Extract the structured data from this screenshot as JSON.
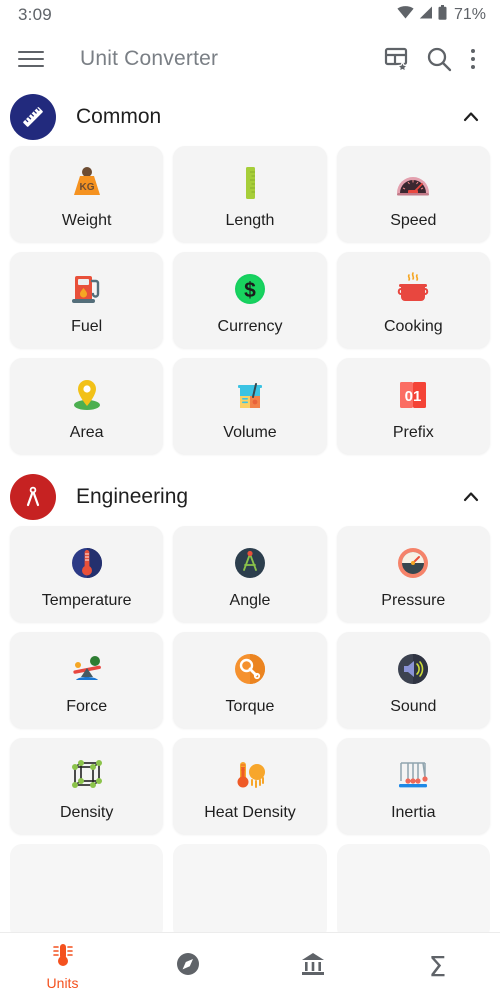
{
  "status_bar": {
    "clock": "3:09",
    "battery_percent": "71%",
    "icons": [
      "wifi-icon",
      "signal-icon",
      "battery-icon"
    ]
  },
  "toolbar": {
    "menu_icon": "hamburger-menu-icon",
    "title": "Unit Converter",
    "actions": [
      {
        "name": "favorites-grid-icon",
        "label": "Favorites"
      },
      {
        "name": "search-icon",
        "label": "Search"
      },
      {
        "name": "overflow-menu-icon",
        "label": "More options"
      }
    ]
  },
  "sections": [
    {
      "title": "Common",
      "badge_icon": "ruler-icon",
      "badge_color": "#222a7d",
      "expanded": true,
      "chevron": "chevron-up-icon",
      "cards": [
        {
          "label": "Weight",
          "icon": "weight-kg-icon"
        },
        {
          "label": "Length",
          "icon": "ruler-green-icon"
        },
        {
          "label": "Speed",
          "icon": "speedometer-icon"
        },
        {
          "label": "Fuel",
          "icon": "fuel-pump-icon"
        },
        {
          "label": "Currency",
          "icon": "dollar-coin-icon"
        },
        {
          "label": "Cooking",
          "icon": "cooking-pot-icon"
        },
        {
          "label": "Area",
          "icon": "map-pin-icon"
        },
        {
          "label": "Volume",
          "icon": "beaker-icon"
        },
        {
          "label": "Prefix",
          "icon": "zero-one-icon"
        }
      ]
    },
    {
      "title": "Engineering",
      "badge_icon": "compass-divider-icon",
      "badge_color": "#c62222",
      "expanded": true,
      "chevron": "chevron-up-icon",
      "cards": [
        {
          "label": "Temperature",
          "icon": "thermometer-icon"
        },
        {
          "label": "Angle",
          "icon": "protractor-compass-icon"
        },
        {
          "label": "Pressure",
          "icon": "pressure-gauge-icon"
        },
        {
          "label": "Force",
          "icon": "seesaw-icon"
        },
        {
          "label": "Torque",
          "icon": "wrench-gear-icon"
        },
        {
          "label": "Sound",
          "icon": "speaker-icon"
        },
        {
          "label": "Density",
          "icon": "lattice-cube-icon"
        },
        {
          "label": "Heat Density",
          "icon": "thermometer-sun-icon"
        },
        {
          "label": "Inertia",
          "icon": "newtons-cradle-icon"
        }
      ]
    }
  ],
  "bottom_nav": {
    "items": [
      {
        "label": "Units",
        "icon": "thermometer-units-icon",
        "active": true
      },
      {
        "label": "",
        "icon": "compass-icon",
        "active": false
      },
      {
        "label": "",
        "icon": "bank-icon",
        "active": false
      },
      {
        "label": "",
        "icon": "sigma-icon",
        "active": false
      }
    ],
    "active_color": "#F4511E",
    "inactive_color": "#5f6368"
  },
  "colors": {
    "card_background": "#f4f4f4",
    "page_background": "#ffffff",
    "title_text": "#7a7f85",
    "body_text": "#1f1f1f",
    "icon_grey": "#5f6368"
  }
}
